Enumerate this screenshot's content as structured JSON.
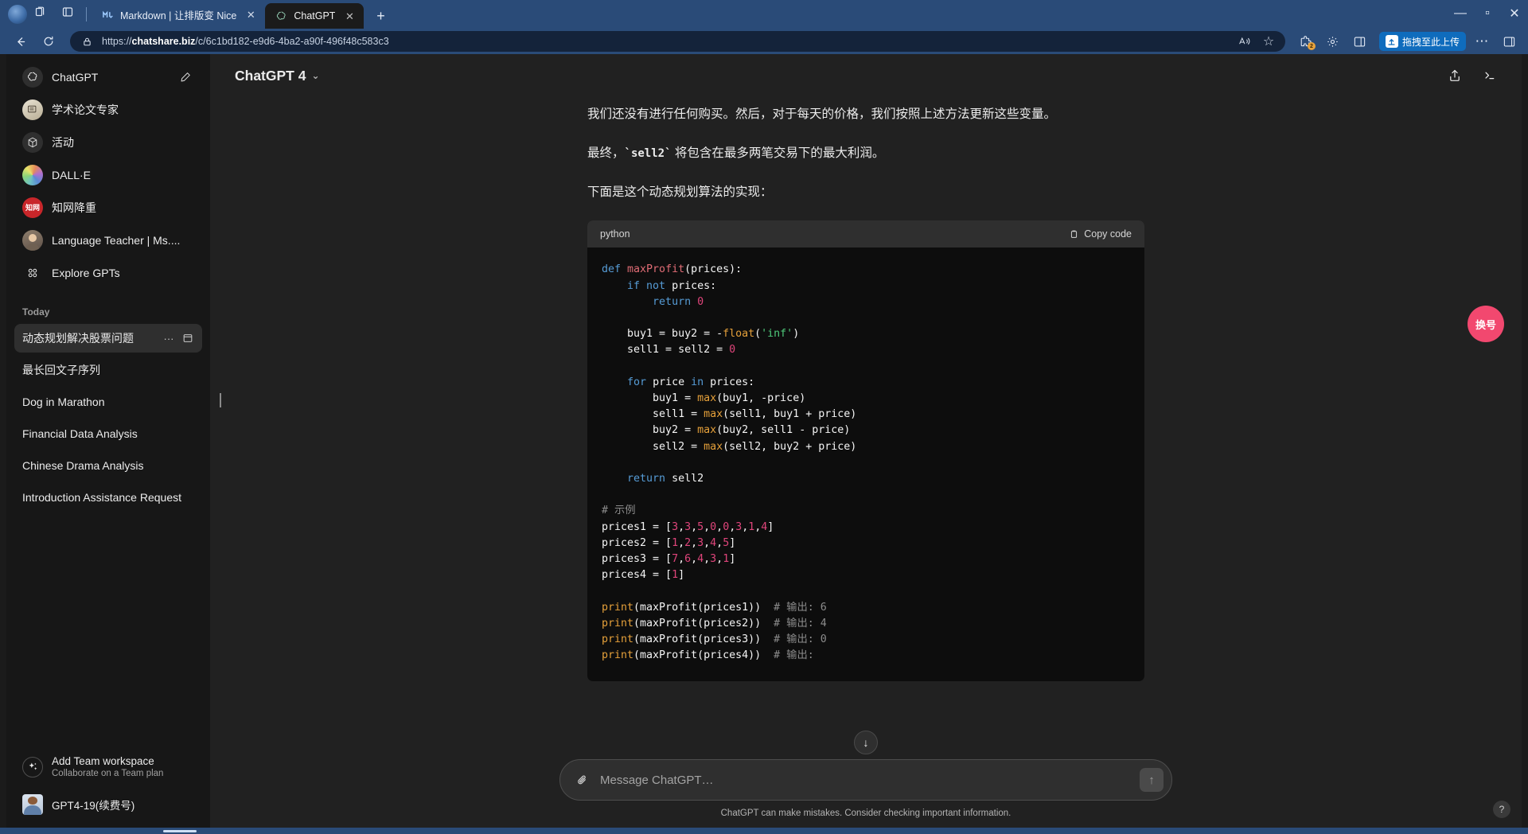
{
  "browser": {
    "tabs": [
      {
        "title": "Markdown | 让排版变 Nice",
        "favicon": "markdown-icon",
        "active": false,
        "close_label": "✕"
      },
      {
        "title": "ChatGPT",
        "favicon": "chatgpt-icon",
        "active": true,
        "close_label": "✕"
      }
    ],
    "new_tab_label": "+",
    "back_label": "←",
    "refresh_label": "↻",
    "lock_icon": "lock-icon",
    "url_prefix": "https://",
    "url_domain": "chatshare.biz",
    "url_path": "/c/6c1bd182-e9d6-4ba2-a90f-496f48c583c3",
    "read_aloud_label": "A",
    "favorite_label": "☆",
    "extension_badge_count": "2",
    "upload_pill_label": "拖拽至此上传",
    "settings_label": "⋯",
    "split_screen_label": "split-screen-icon",
    "collections_label": "collections-icon",
    "window_minimize": "—",
    "window_maximize": "▫",
    "window_close": "✕"
  },
  "sidebar": {
    "gpts": [
      {
        "label": "ChatGPT",
        "avatar": "chatgpt-logo-icon"
      },
      {
        "label": "学术论文专家",
        "avatar": "academic-paper-icon"
      },
      {
        "label": "活动",
        "avatar": "activity-cube-icon"
      },
      {
        "label": "DALL·E",
        "avatar": "dalle-icon"
      },
      {
        "label": "知网降重",
        "avatar": "cnki-icon"
      },
      {
        "label": "Language Teacher | Ms....",
        "avatar": "language-teacher-icon"
      },
      {
        "label": "Explore GPTs",
        "avatar": "explore-gpts-icon"
      }
    ],
    "new_chat_icon": "new-chat-icon",
    "history_heading": "Today",
    "history": [
      {
        "label": "动态规划解决股票问题",
        "active": true
      },
      {
        "label": "最长回文子序列",
        "active": false
      },
      {
        "label": "Dog in Marathon",
        "active": false
      },
      {
        "label": "Financial Data Analysis",
        "active": false
      },
      {
        "label": "Chinese Drama Analysis",
        "active": false
      },
      {
        "label": "Introduction Assistance Request",
        "active": false
      }
    ],
    "history_more_label": "···",
    "history_archive_label": "archive-icon",
    "team": {
      "title": "Add Team workspace",
      "subtitle": "Collaborate on a Team plan",
      "icon": "sparkles-icon"
    },
    "account": {
      "name": "GPT4-19(续费号)",
      "avatar": "user-avatar"
    }
  },
  "main": {
    "model_name": "ChatGPT 4",
    "model_chevron": "⌄",
    "share_icon": "share-icon",
    "terminal_icon": "terminal-icon",
    "paragraphs": [
      {
        "text": "我们还没有进行任何购买。然后，对于每天的价格，我们按照上述方法更新这些变量。"
      },
      {
        "prefix": "最终，",
        "code": "sell2",
        "suffix": " 将包含在最多两笔交易下的最大利润。"
      },
      {
        "text": "下面是这个动态规划算法的实现："
      }
    ],
    "code_block": {
      "language": "python",
      "copy_label": "Copy code",
      "copy_icon": "clipboard-icon",
      "lines": [
        [
          {
            "t": "def ",
            "c": "k"
          },
          {
            "t": "maxProfit",
            "c": "fn"
          },
          {
            "t": "(prices):",
            "c": "pl"
          }
        ],
        [
          {
            "t": "    ",
            "c": "pl"
          },
          {
            "t": "if not ",
            "c": "k"
          },
          {
            "t": "prices:",
            "c": "pl"
          }
        ],
        [
          {
            "t": "        ",
            "c": "pl"
          },
          {
            "t": "return ",
            "c": "k"
          },
          {
            "t": "0",
            "c": "num"
          }
        ],
        [
          {
            "t": "",
            "c": "pl"
          }
        ],
        [
          {
            "t": "    buy1 = buy2 = -",
            "c": "pl"
          },
          {
            "t": "float",
            "c": "bi"
          },
          {
            "t": "(",
            "c": "pl"
          },
          {
            "t": "'inf'",
            "c": "str"
          },
          {
            "t": ")",
            "c": "pl"
          }
        ],
        [
          {
            "t": "    sell1 = sell2 = ",
            "c": "pl"
          },
          {
            "t": "0",
            "c": "num"
          }
        ],
        [
          {
            "t": "",
            "c": "pl"
          }
        ],
        [
          {
            "t": "    ",
            "c": "pl"
          },
          {
            "t": "for ",
            "c": "k"
          },
          {
            "t": "price ",
            "c": "pl"
          },
          {
            "t": "in ",
            "c": "k"
          },
          {
            "t": "prices:",
            "c": "pl"
          }
        ],
        [
          {
            "t": "        buy1 = ",
            "c": "pl"
          },
          {
            "t": "max",
            "c": "bi"
          },
          {
            "t": "(buy1, -price)",
            "c": "pl"
          }
        ],
        [
          {
            "t": "        sell1 = ",
            "c": "pl"
          },
          {
            "t": "max",
            "c": "bi"
          },
          {
            "t": "(sell1, buy1 + price)",
            "c": "pl"
          }
        ],
        [
          {
            "t": "        buy2 = ",
            "c": "pl"
          },
          {
            "t": "max",
            "c": "bi"
          },
          {
            "t": "(buy2, sell1 - price)",
            "c": "pl"
          }
        ],
        [
          {
            "t": "        sell2 = ",
            "c": "pl"
          },
          {
            "t": "max",
            "c": "bi"
          },
          {
            "t": "(sell2, buy2 + price)",
            "c": "pl"
          }
        ],
        [
          {
            "t": "",
            "c": "pl"
          }
        ],
        [
          {
            "t": "    ",
            "c": "pl"
          },
          {
            "t": "return ",
            "c": "k"
          },
          {
            "t": "sell2",
            "c": "pl"
          }
        ],
        [
          {
            "t": "",
            "c": "pl"
          }
        ],
        [
          {
            "t": "# 示例",
            "c": "cm"
          }
        ],
        [
          {
            "t": "prices1 = [",
            "c": "pl"
          },
          {
            "t": "3",
            "c": "num"
          },
          {
            "t": ",",
            "c": "pl"
          },
          {
            "t": "3",
            "c": "num"
          },
          {
            "t": ",",
            "c": "pl"
          },
          {
            "t": "5",
            "c": "num"
          },
          {
            "t": ",",
            "c": "pl"
          },
          {
            "t": "0",
            "c": "num"
          },
          {
            "t": ",",
            "c": "pl"
          },
          {
            "t": "0",
            "c": "num"
          },
          {
            "t": ",",
            "c": "pl"
          },
          {
            "t": "3",
            "c": "num"
          },
          {
            "t": ",",
            "c": "pl"
          },
          {
            "t": "1",
            "c": "num"
          },
          {
            "t": ",",
            "c": "pl"
          },
          {
            "t": "4",
            "c": "num"
          },
          {
            "t": "]",
            "c": "pl"
          }
        ],
        [
          {
            "t": "prices2 = [",
            "c": "pl"
          },
          {
            "t": "1",
            "c": "num"
          },
          {
            "t": ",",
            "c": "pl"
          },
          {
            "t": "2",
            "c": "num"
          },
          {
            "t": ",",
            "c": "pl"
          },
          {
            "t": "3",
            "c": "num"
          },
          {
            "t": ",",
            "c": "pl"
          },
          {
            "t": "4",
            "c": "num"
          },
          {
            "t": ",",
            "c": "pl"
          },
          {
            "t": "5",
            "c": "num"
          },
          {
            "t": "]",
            "c": "pl"
          }
        ],
        [
          {
            "t": "prices3 = [",
            "c": "pl"
          },
          {
            "t": "7",
            "c": "num"
          },
          {
            "t": ",",
            "c": "pl"
          },
          {
            "t": "6",
            "c": "num"
          },
          {
            "t": ",",
            "c": "pl"
          },
          {
            "t": "4",
            "c": "num"
          },
          {
            "t": ",",
            "c": "pl"
          },
          {
            "t": "3",
            "c": "num"
          },
          {
            "t": ",",
            "c": "pl"
          },
          {
            "t": "1",
            "c": "num"
          },
          {
            "t": "]",
            "c": "pl"
          }
        ],
        [
          {
            "t": "prices4 = [",
            "c": "pl"
          },
          {
            "t": "1",
            "c": "num"
          },
          {
            "t": "]",
            "c": "pl"
          }
        ],
        [
          {
            "t": "",
            "c": "pl"
          }
        ],
        [
          {
            "t": "print",
            "c": "bi"
          },
          {
            "t": "(maxProfit(prices1))  ",
            "c": "pl"
          },
          {
            "t": "# 输出: 6",
            "c": "cm"
          }
        ],
        [
          {
            "t": "print",
            "c": "bi"
          },
          {
            "t": "(maxProfit(prices2))  ",
            "c": "pl"
          },
          {
            "t": "# 输出: 4",
            "c": "cm"
          }
        ],
        [
          {
            "t": "print",
            "c": "bi"
          },
          {
            "t": "(maxProfit(prices3))  ",
            "c": "pl"
          },
          {
            "t": "# 输出: 0",
            "c": "cm"
          }
        ],
        [
          {
            "t": "print",
            "c": "bi"
          },
          {
            "t": "(maxProfit(prices4))  ",
            "c": "pl"
          },
          {
            "t": "# 输出:",
            "c": "cm"
          }
        ]
      ]
    },
    "scroll_down_label": "↓",
    "float_pill_label": "换号",
    "help_label": "?"
  },
  "composer": {
    "placeholder": "Message ChatGPT…",
    "value": "",
    "attach_icon": "paperclip-icon",
    "send_label": "↑",
    "disclaimer": "ChatGPT can make mistakes. Consider checking important information."
  },
  "colors": {
    "accent_blue": "#2a4b78",
    "sidebar_bg": "#171717",
    "main_bg": "#212121",
    "code_bg": "#0d0d0d",
    "pill_pink": "#f2486f",
    "upload_blue": "#0f6cbd"
  }
}
